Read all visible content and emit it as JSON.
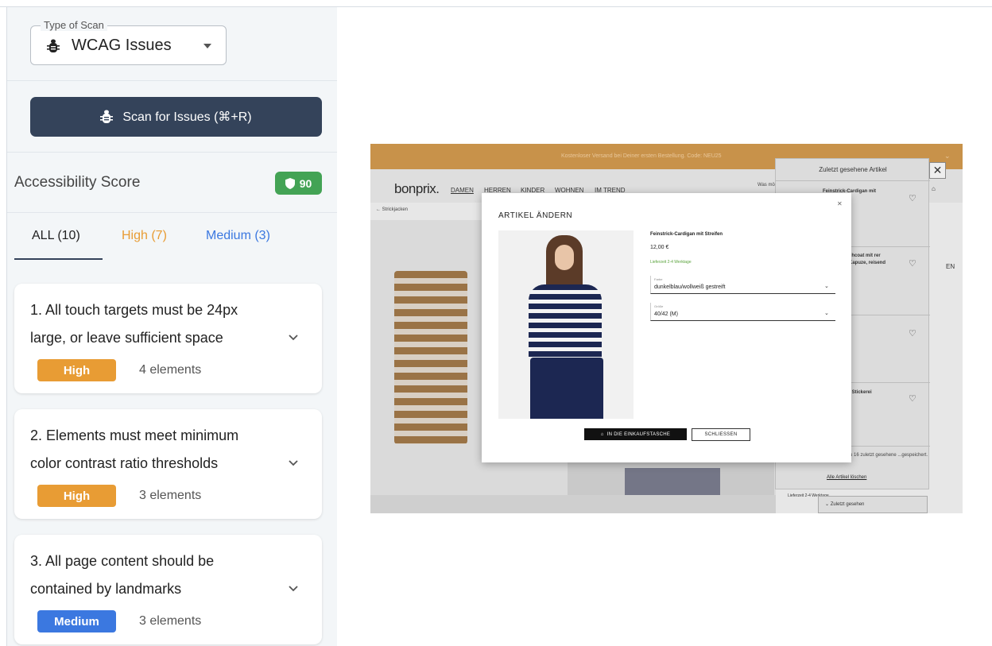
{
  "scan_type": {
    "legend": "Type of Scan",
    "value": "WCAG Issues"
  },
  "scan_button": {
    "label": "Scan for Issues (⌘+R)"
  },
  "score": {
    "label": "Accessibility Score",
    "value": "90",
    "color": "#43a355"
  },
  "tabs": [
    {
      "label": "ALL (10)",
      "color": "#222222"
    },
    {
      "label": "High (7)",
      "color": "#e89c34"
    },
    {
      "label": "Medium (3)",
      "color": "#3b78e0"
    }
  ],
  "issues": [
    {
      "title": "1. All touch targets must be 24px large, or leave sufficient space",
      "severity": "High",
      "count": "4 elements",
      "color": "#e89c34"
    },
    {
      "title": "2. Elements must meet minimum color contrast ratio thresholds",
      "severity": "High",
      "count": "3 elements",
      "color": "#e89c34"
    },
    {
      "title": "3. All page content should be contained by landmarks",
      "severity": "Medium",
      "count": "3 elements",
      "color": "#3b78e0"
    }
  ],
  "preview": {
    "topbar": "Kostenloser Versand bei Deiner ersten Bestellung. Code: NEU25",
    "logo": "bonprix.",
    "nav": [
      "DAMEN",
      "HERREN",
      "KINDER",
      "WOHNEN",
      "IM TREND"
    ],
    "search": "Was mö",
    "back": "Strickjacken",
    "right_text": "EN",
    "recent": {
      "title": "Zuletzt gesehene Artikel",
      "items": [
        "Feinstrick-Cardigan mit",
        "chcoat mit rer Kapuze, reisend",
        "t Stickerei"
      ],
      "note": "zu 16 zuletzt gesehene ...gespeichert.",
      "delete": "Alle Artikel löschen"
    },
    "lieferzeit": "Lieferzeit 2-4 Werktage",
    "zuletzt_bar": "Zuletzt gesehen",
    "modal": {
      "title": "ARTIKEL ÄNDERN",
      "product": "Feinstrick-Cardigan mit Streifen",
      "price": "12,00 €",
      "delivery": "Lieferzeit 2-4 Werktage",
      "color_label": "Farbe",
      "color_value": "dunkelblau/wollweiß gestreift",
      "size_label": "Größe",
      "size_value": "40/42 (M)",
      "add_button": "IN DIE EINKAUFSTASCHE",
      "close_button": "SCHLIESSEN"
    }
  }
}
